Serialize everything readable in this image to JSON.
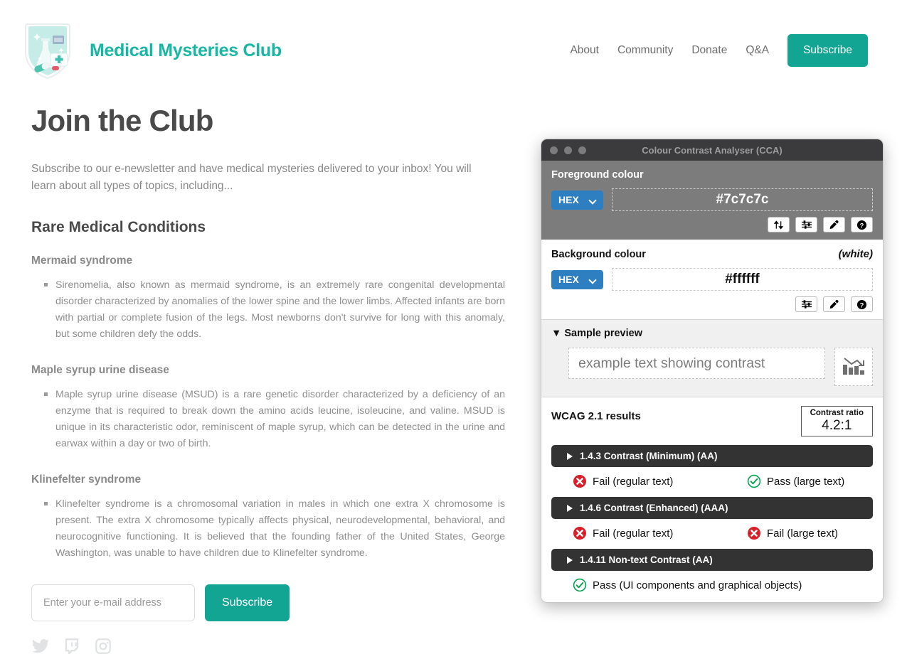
{
  "header": {
    "logo_icon": "medical-shield-logo",
    "brand": "Medical Mysteries Club",
    "nav": [
      {
        "label": "About"
      },
      {
        "label": "Community"
      },
      {
        "label": "Donate"
      },
      {
        "label": "Q&A"
      }
    ],
    "subscribe_button": "Subscribe"
  },
  "main": {
    "title": "Join the Club",
    "intro": "Subscribe to our e-newsletter and have medical mysteries delivered to your inbox! You will learn about all types of topics, including...",
    "section_title": "Rare Medical Conditions",
    "conditions": [
      {
        "name": "Mermaid syndrome",
        "body": "Sirenomelia, also known as mermaid syndrome, is an extremely rare congenital developmental disorder characterized by anomalies of the lower spine and the lower limbs. Affected infants are born with partial or complete fusion of the legs. Most newborns don't survive for long with this anomaly, but some children defy the odds."
      },
      {
        "name": "Maple syrup urine disease",
        "body": "Maple syrup urine disease (MSUD) is a rare genetic disorder characterized by a deficiency of an enzyme that is required to break down the amino acids leucine, isoleucine, and valine. MSUD is unique in its characteristic odor, reminiscent of maple syrup, which can be detected in the urine and earwax within a day or two of birth."
      },
      {
        "name": "Klinefelter syndrome",
        "body": "Klinefelter syndrome is a chromosomal variation in males in which one extra X chromosome is present. The extra X chromosome typically affects physical, neurodevelopmental, behavioral, and neurocognitive functioning. It is believed that the founding father of the United States, George Washington, was unable to have children due to Klinefelter syndrome."
      }
    ],
    "form": {
      "email_placeholder": "Enter your e-mail address",
      "email_value": "",
      "submit_label": "Subscribe"
    },
    "socials": [
      {
        "icon": "twitter-icon"
      },
      {
        "icon": "twitch-icon"
      },
      {
        "icon": "instagram-icon"
      }
    ]
  },
  "cca": {
    "window_title": "Colour Contrast Analyser (CCA)",
    "foreground": {
      "label": "Foreground colour",
      "format": "HEX",
      "value": "#7c7c7c",
      "swatch": "#7c7c7c",
      "buttons": [
        {
          "icon": "swap-arrows-icon"
        },
        {
          "icon": "sliders-icon"
        },
        {
          "icon": "eyedropper-icon"
        },
        {
          "icon": "help-icon"
        }
      ]
    },
    "background": {
      "label": "Background colour",
      "note": "(white)",
      "format": "HEX",
      "value": "#ffffff",
      "swatch": "#ffffff",
      "buttons": [
        {
          "icon": "sliders-icon"
        },
        {
          "icon": "eyedropper-icon"
        },
        {
          "icon": "help-icon"
        }
      ]
    },
    "preview": {
      "label": "Sample preview",
      "sample_text": "example text showing contrast",
      "image_icon": "declining-bar-chart-icon"
    },
    "results": {
      "title": "WCAG 2.1 results",
      "ratio_label": "Contrast ratio",
      "ratio_value": "4.2:1",
      "criteria": [
        {
          "name": "1.4.3 Contrast (Minimum) (AA)",
          "outcomes": [
            {
              "status": "fail",
              "text": "Fail (regular text)"
            },
            {
              "status": "pass",
              "text": "Pass (large text)"
            }
          ]
        },
        {
          "name": "1.4.6 Contrast (Enhanced) (AAA)",
          "outcomes": [
            {
              "status": "fail",
              "text": "Fail (regular text)"
            },
            {
              "status": "fail",
              "text": "Fail (large text)"
            }
          ]
        },
        {
          "name": "1.4.11 Non-text Contrast (AA)",
          "outcomes": [
            {
              "status": "pass",
              "text": "Pass (UI components and graphical objects)"
            }
          ]
        }
      ]
    }
  },
  "colors": {
    "brand_teal": "#16b8a3",
    "button_teal": "#12a594",
    "fail_red": "#d8202a",
    "pass_green": "#00a550",
    "select_blue": "#2d7fc1"
  }
}
